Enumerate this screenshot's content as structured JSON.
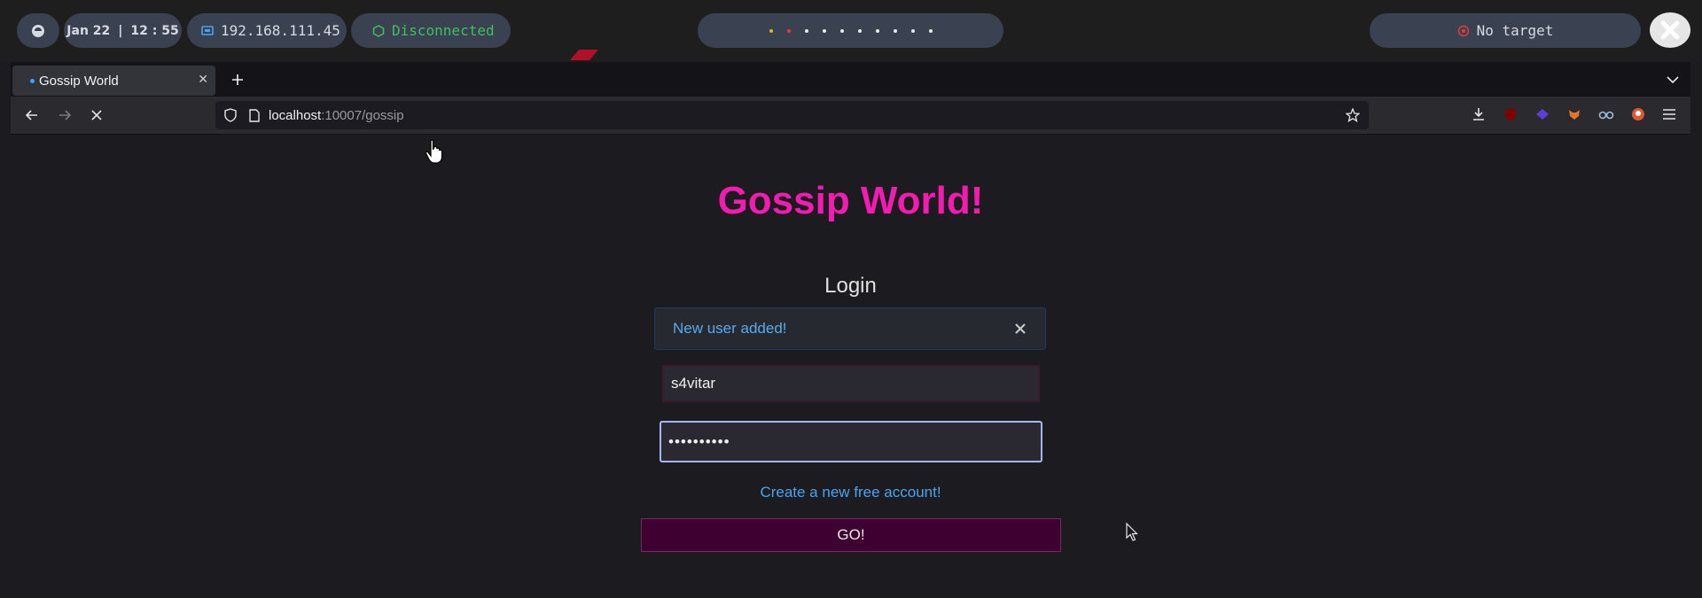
{
  "desktop": {
    "date": "Jan 22",
    "time": "12 : 55",
    "ip": "192.168.111.45",
    "vpn_status": "Disconnected",
    "vpn_color": "#3fbf5f",
    "target": "No target",
    "workspace_active_colors": [
      "#f0b400",
      "#e83a3a"
    ],
    "workspace_count": 10
  },
  "browser": {
    "tab_title": "Gossip World",
    "url_host": "localhost",
    "url_rest": ":10007/gossip"
  },
  "page": {
    "title": "Gossip World!",
    "title_color": "#f31bb0",
    "login_heading": "Login",
    "alert_message": "New user added!",
    "username_value": "s4vitar",
    "password_value": "••••••••••",
    "create_account_link": "Create a new free account!",
    "go_button": "GO!"
  }
}
